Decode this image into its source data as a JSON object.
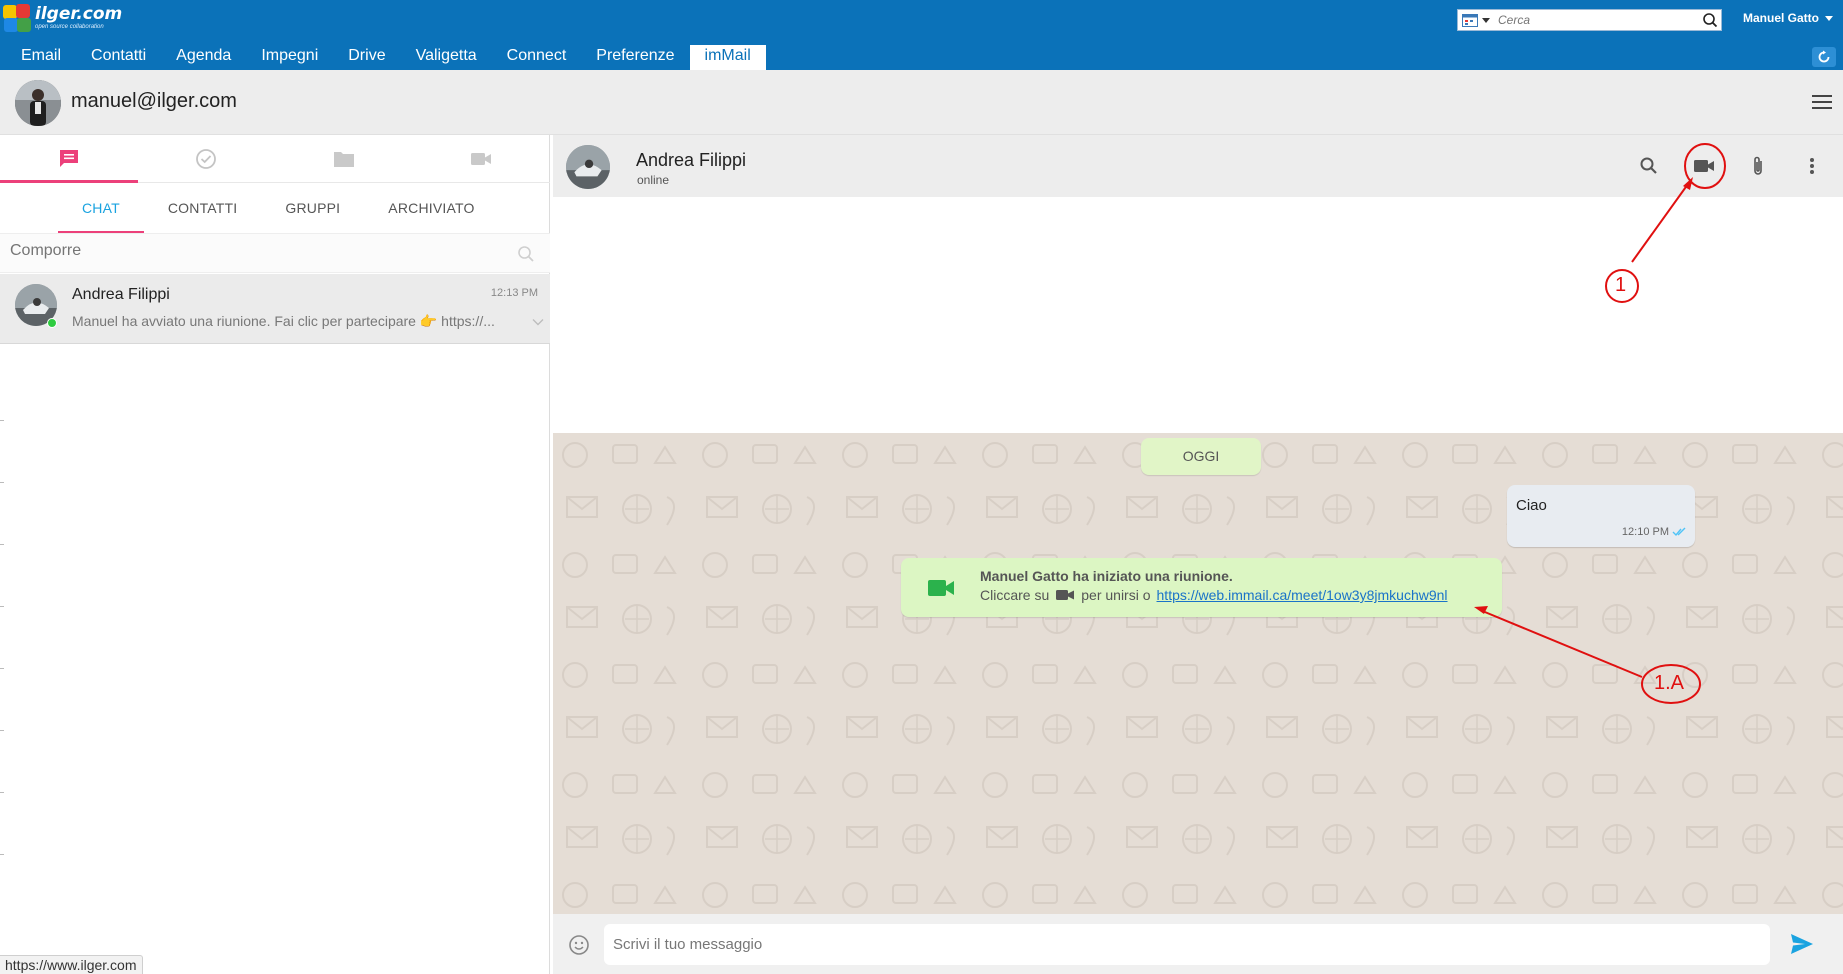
{
  "brand": {
    "name": "ilger.com",
    "tagline": "open source collaboration"
  },
  "topbar": {
    "search_placeholder": "Cerca",
    "user_name": "Manuel Gatto"
  },
  "nav": {
    "items": [
      {
        "label": "Email"
      },
      {
        "label": "Contatti"
      },
      {
        "label": "Agenda"
      },
      {
        "label": "Impegni"
      },
      {
        "label": "Drive"
      },
      {
        "label": "Valigetta"
      },
      {
        "label": "Connect"
      },
      {
        "label": "Preferenze"
      },
      {
        "label": "imMail",
        "active": true
      }
    ]
  },
  "account": {
    "email": "manuel@ilger.com"
  },
  "left": {
    "icon_tabs": [
      "chat-icon",
      "check-circle-icon",
      "folder-icon",
      "video-camera-icon"
    ],
    "sub_tabs": [
      {
        "label": "CHAT",
        "active": true
      },
      {
        "label": "CONTATTI"
      },
      {
        "label": "GRUPPI"
      },
      {
        "label": "ARCHIVIATO"
      }
    ],
    "compose_placeholder": "Comporre",
    "chats": [
      {
        "name": "Andrea Filippi",
        "time": "12:13 PM",
        "preview": "Manuel ha avviato una riunione. Fai clic per partecipare 👉 https://...",
        "online": true
      }
    ]
  },
  "conversation": {
    "contact_name": "Andrea Filippi",
    "contact_status": "online",
    "date_chip": "OGGI",
    "outgoing": {
      "text": "Ciao",
      "time": "12:10 PM"
    },
    "meeting": {
      "title": "Manuel Gatto ha iniziato una riunione.",
      "prefix": "Cliccare su",
      "suffix": "per unirsi o",
      "link": "https://web.immail.ca/meet/1ow3y8jmkuchw9nl"
    },
    "composer_placeholder": "Scrivi il tuo messaggio"
  },
  "annotations": {
    "label_1": "1",
    "label_1a": "1.A"
  },
  "status_bar": {
    "url": "https://www.ilger.com"
  },
  "colors": {
    "topbar": "#0b72b9",
    "accent_pink": "#ec407a",
    "accent_blue": "#1aa3e0",
    "chat_bg": "#e5ddd5",
    "bubble_green": "#dcf6c3",
    "annotation_red": "#e01010"
  }
}
